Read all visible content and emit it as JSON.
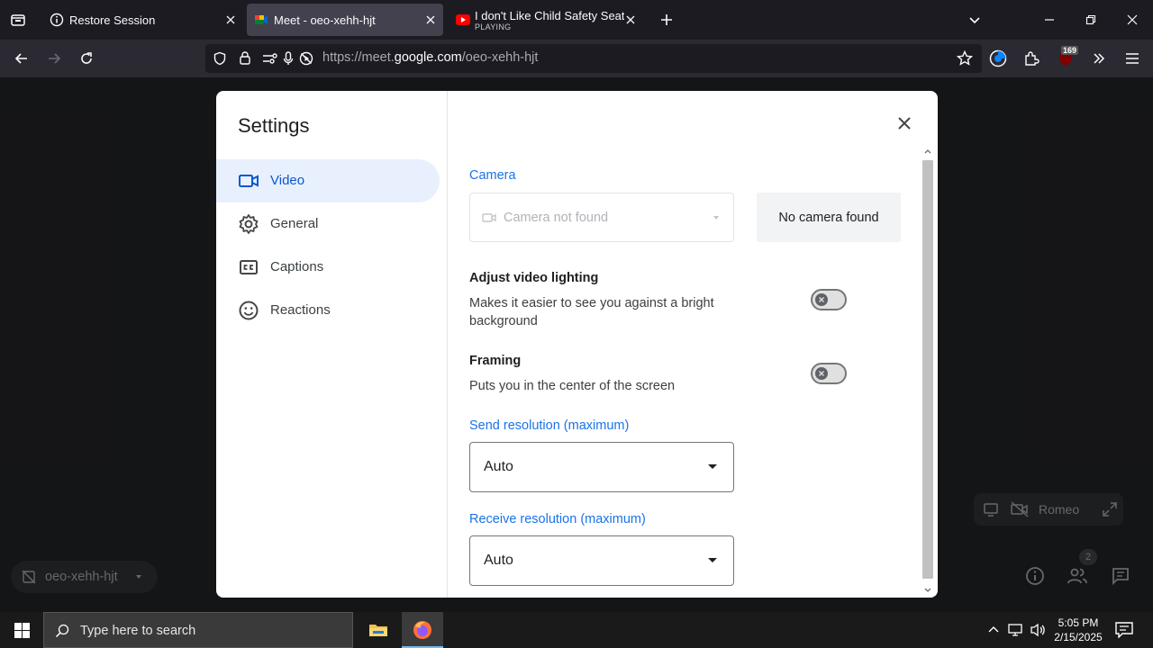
{
  "tabs": [
    {
      "title": "Restore Session",
      "subtitle": ""
    },
    {
      "title": "Meet - oeo-xehh-hjt",
      "subtitle": ""
    },
    {
      "title": "I don't Like Child Safety Seat | P",
      "subtitle": "PLAYING"
    }
  ],
  "navbar": {
    "url_prefix": "https://meet.",
    "url_domain": "google.com",
    "url_path": "/oeo-xehh-hjt",
    "badge_count": "169"
  },
  "settings": {
    "title": "Settings",
    "nav": [
      {
        "label": "Video",
        "icon": "videocam-icon"
      },
      {
        "label": "General",
        "icon": "gear-icon"
      },
      {
        "label": "Captions",
        "icon": "captions-icon"
      },
      {
        "label": "Reactions",
        "icon": "smiley-icon"
      }
    ],
    "camera_heading": "Camera",
    "camera_select": "Camera not found",
    "camera_preview": "No camera found",
    "lighting_title": "Adjust video lighting",
    "lighting_desc": "Makes it easier to see you against a bright background",
    "framing_title": "Framing",
    "framing_desc": "Puts you in the center of the screen",
    "send_heading": "Send resolution (maximum)",
    "send_value": "Auto",
    "receive_heading": "Receive resolution (maximum)",
    "receive_value": "Auto"
  },
  "meet": {
    "participant": "Romeo",
    "meeting_code": "oeo-xehh-hjt",
    "people_count": "2"
  },
  "taskbar": {
    "search_placeholder": "Type here to search",
    "time": "5:05 PM",
    "date": "2/15/2025"
  },
  "colors": {
    "accent": "#1a73e8",
    "active_nav_bg": "#e8f0fe"
  }
}
